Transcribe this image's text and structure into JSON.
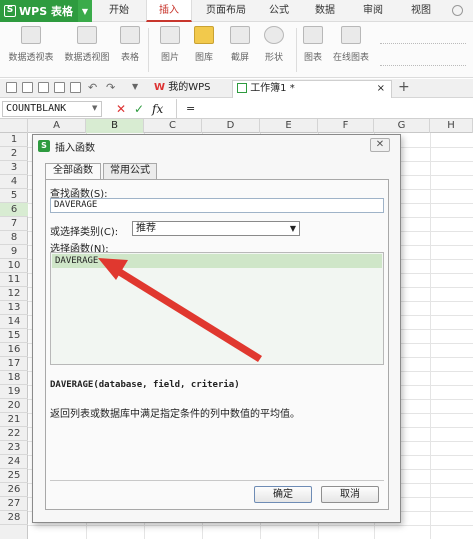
{
  "app": {
    "name": "WPS 表格",
    "logo": "S"
  },
  "menu": {
    "tabs": [
      "开始",
      "插入",
      "页面布局",
      "公式",
      "数据",
      "审阅",
      "视图"
    ],
    "active": "插入"
  },
  "ribbon": {
    "items": [
      {
        "label": "数据透视表",
        "icon": "pivot-table-icon"
      },
      {
        "label": "数据透视图",
        "icon": "pivot-chart-icon"
      },
      {
        "label": "表格",
        "icon": "table-icon"
      },
      {
        "label": "图片",
        "icon": "picture-icon"
      },
      {
        "label": "图库",
        "icon": "gallery-icon"
      },
      {
        "label": "截屏",
        "icon": "screenshot-icon"
      },
      {
        "label": "形状",
        "icon": "shape-icon"
      },
      {
        "label": "图表",
        "icon": "chart-icon"
      },
      {
        "label": "在线图表",
        "icon": "online-chart-icon"
      }
    ]
  },
  "doc_tabs": {
    "home": "我的WPS",
    "workbook": "工作簿1 *",
    "close": "×",
    "add": "+"
  },
  "formula_bar": {
    "name_box": "COUNTBLANK",
    "cancel": "✕",
    "confirm": "✓",
    "fx": "fx",
    "content": "="
  },
  "grid": {
    "columns": [
      "A",
      "B",
      "C",
      "D",
      "E",
      "F",
      "G",
      "H"
    ],
    "selected_column": "B",
    "rows": [
      "1",
      "2",
      "3",
      "4",
      "5",
      "6",
      "7",
      "8",
      "9",
      "10",
      "11",
      "12",
      "13",
      "14",
      "15",
      "16",
      "17",
      "18",
      "19",
      "20",
      "21",
      "22",
      "23",
      "24",
      "25",
      "26",
      "27",
      "28"
    ],
    "selected_row": "6"
  },
  "dialog": {
    "title": "插入函数",
    "close": "✕",
    "tabs": [
      "全部函数",
      "常用公式"
    ],
    "search_label": "查找函数(S):",
    "search_value": "DAVERAGE",
    "category_label": "或选择类别(C):",
    "category_value": "推荐",
    "list_label": "选择函数(N):",
    "selected_function": "DAVERAGE",
    "syntax": "DAVERAGE(database, field, criteria)",
    "description": "返回列表或数据库中满足指定条件的列中数值的平均值。",
    "ok": "确定",
    "cancel": "取消"
  },
  "colors": {
    "brand_green": "#2e9b3f",
    "accent_red": "#e0382f",
    "selection_green": "#cfe6c8"
  }
}
